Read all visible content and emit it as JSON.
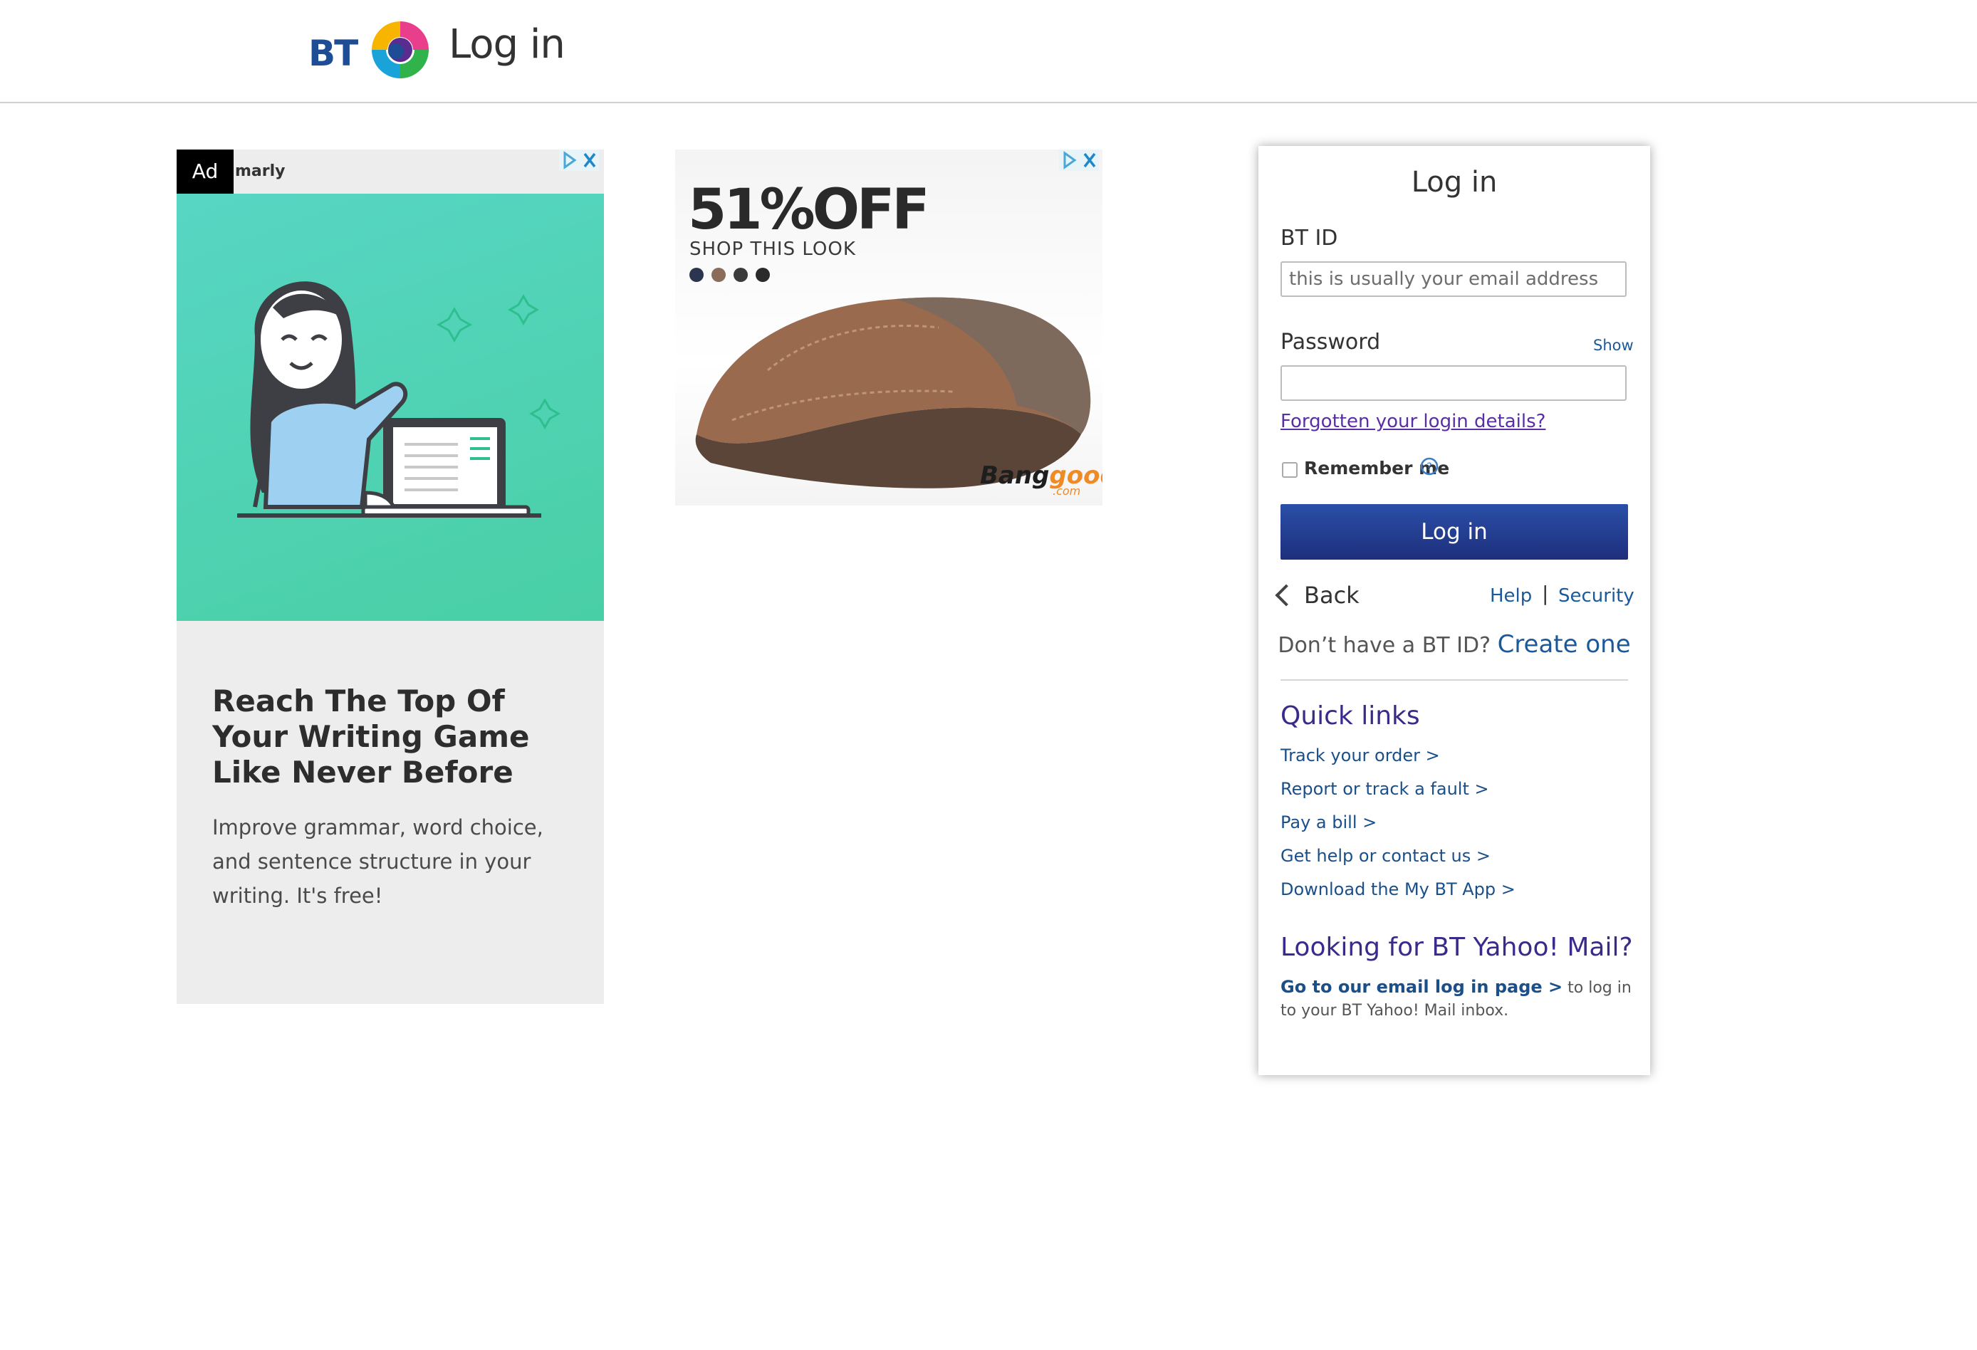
{
  "header": {
    "logo_text": "BT",
    "title": "Log in"
  },
  "ad1": {
    "badge": "Ad",
    "brand": "marly",
    "headline": "Reach The Top Of Your Writing Game Like Never Before",
    "body": "Improve grammar, word choice, and sentence structure in your writing. It's free!"
  },
  "ad2": {
    "discount": "51%OFF",
    "subtitle": "SHOP THIS LOOK",
    "brand_prefix": "Bang",
    "brand_suffix": "good",
    "brand_domain": ".com",
    "swatches": [
      "#2b3550",
      "#8b6b5a",
      "#3b3b3b",
      "#2a2a2a"
    ]
  },
  "login": {
    "title": "Log in",
    "bt_id_label": "BT ID",
    "bt_id_placeholder": "this is usually your email address",
    "password_label": "Password",
    "show_label": "Show",
    "forgot_label": "Forgotten your login details?",
    "remember_label": "Remember me",
    "login_button": "Log in",
    "back_label": "Back",
    "help_label": "Help",
    "separator": "|",
    "security_label": "Security",
    "no_id_text": "Don’t have a BT ID?",
    "create_label": "Create one"
  },
  "quick_links": {
    "title": "Quick links",
    "items": [
      "Track your order >",
      "Report or track a fault >",
      "Pay a bill >",
      "Get help or contact us >",
      "Download the My BT App >"
    ]
  },
  "yahoo": {
    "title": "Looking for BT Yahoo! Mail?",
    "link_label": "Go to our email log in page >",
    "text": " to log in to your BT Yahoo! Mail inbox."
  }
}
